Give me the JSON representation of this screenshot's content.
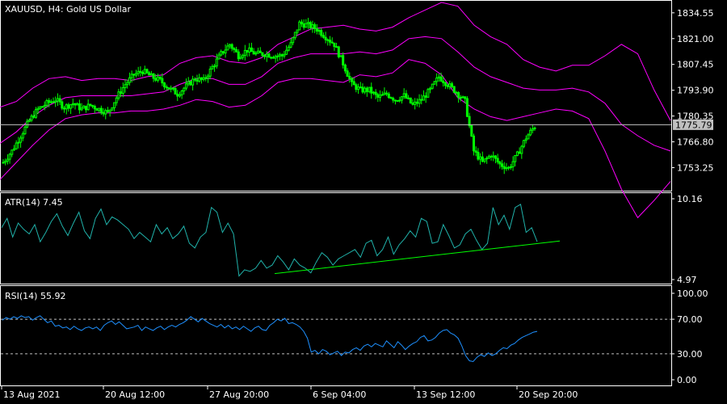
{
  "panes": {
    "main": {
      "symbol": "XAUUSD",
      "timeframe": "H4",
      "title": "XAUUSD, H4:  Gold US Dollar",
      "current_price": "1775.79"
    },
    "atr": {
      "title": "ATR(14) 7.45"
    },
    "rsi": {
      "title": "RSI(14) 55.92"
    }
  },
  "colors": {
    "background": "#000000",
    "candle": "#00ff00",
    "bollinger": "#ff00ff",
    "atr_line": "#20b2aa",
    "atr_trendline": "#00ff00",
    "rsi_line": "#1e90ff",
    "grid_level": "#c0c0c0",
    "axis_text": "#ffffff",
    "price_box": "#c0c0c0"
  },
  "chart_data": [
    {
      "type": "candlestick",
      "name": "main",
      "y_axis_ticks": [
        "1834.55",
        "1821.00",
        "1807.45",
        "1793.90",
        "1780.35",
        "1766.80",
        "1753.25"
      ],
      "ylim": [
        1742,
        1840
      ],
      "current_price": 1775.79,
      "close_path_points": [
        [
          0,
          1756
        ],
        [
          4,
          1762
        ],
        [
          8,
          1770
        ],
        [
          12,
          1778
        ],
        [
          16,
          1784
        ],
        [
          20,
          1787
        ],
        [
          24,
          1789
        ],
        [
          28,
          1785
        ],
        [
          32,
          1787
        ],
        [
          36,
          1784
        ],
        [
          40,
          1786
        ],
        [
          44,
          1784
        ],
        [
          48,
          1782
        ],
        [
          52,
          1790
        ],
        [
          56,
          1797
        ],
        [
          60,
          1802
        ],
        [
          64,
          1804
        ],
        [
          68,
          1801
        ],
        [
          72,
          1799
        ],
        [
          76,
          1795
        ],
        [
          80,
          1792
        ],
        [
          84,
          1796
        ],
        [
          88,
          1800
        ],
        [
          92,
          1799
        ],
        [
          96,
          1806
        ],
        [
          100,
          1813
        ],
        [
          104,
          1818
        ],
        [
          108,
          1812
        ],
        [
          112,
          1815
        ],
        [
          116,
          1813
        ],
        [
          120,
          1813
        ],
        [
          124,
          1812
        ],
        [
          128,
          1812
        ],
        [
          132,
          1818
        ],
        [
          136,
          1829
        ],
        [
          140,
          1828
        ],
        [
          144,
          1826
        ],
        [
          148,
          1822
        ],
        [
          152,
          1818
        ],
        [
          156,
          1808
        ],
        [
          160,
          1797
        ],
        [
          164,
          1794
        ],
        [
          168,
          1794
        ],
        [
          172,
          1790
        ],
        [
          176,
          1792
        ],
        [
          180,
          1789
        ],
        [
          184,
          1791
        ],
        [
          188,
          1786
        ],
        [
          192,
          1789
        ],
        [
          196,
          1794
        ],
        [
          200,
          1801
        ],
        [
          204,
          1797
        ],
        [
          208,
          1793
        ],
        [
          212,
          1788
        ],
        [
          216,
          1762
        ],
        [
          220,
          1756
        ],
        [
          224,
          1760
        ],
        [
          228,
          1755
        ],
        [
          232,
          1753
        ],
        [
          236,
          1760
        ],
        [
          240,
          1769
        ],
        [
          244,
          1775
        ]
      ],
      "close_x_range": [
        0,
        244
      ],
      "bb_upper": [
        1785,
        1788,
        1795,
        1800,
        1801,
        1799,
        1800,
        1800,
        1799,
        1801,
        1802,
        1808,
        1811,
        1812,
        1809,
        1808,
        1811,
        1818,
        1822,
        1826,
        1827,
        1828,
        1826,
        1825,
        1827,
        1832,
        1836,
        1840,
        1838,
        1828,
        1822,
        1818,
        1810,
        1806,
        1804,
        1807,
        1807,
        1812,
        1818,
        1813,
        1794,
        1778
      ],
      "bb_middle": [
        1766,
        1772,
        1780,
        1786,
        1790,
        1791,
        1791,
        1791,
        1791,
        1792,
        1793,
        1797,
        1800,
        1800,
        1797,
        1797,
        1801,
        1808,
        1811,
        1813,
        1813,
        1813,
        1814,
        1813,
        1815,
        1821,
        1822,
        1821,
        1814,
        1806,
        1801,
        1798,
        1795,
        1794,
        1794,
        1795,
        1793,
        1787,
        1776,
        1770,
        1765,
        1762
      ],
      "bb_lower": [
        1747,
        1756,
        1765,
        1773,
        1779,
        1781,
        1782,
        1782,
        1783,
        1783,
        1784,
        1786,
        1789,
        1788,
        1785,
        1786,
        1791,
        1798,
        1800,
        1800,
        1799,
        1798,
        1802,
        1801,
        1803,
        1810,
        1808,
        1802,
        1790,
        1784,
        1780,
        1778,
        1780,
        1782,
        1784,
        1783,
        1779,
        1762,
        1742,
        1727,
        1736,
        1746
      ]
    },
    {
      "type": "line",
      "name": "atr",
      "title": "ATR(14) 7.45",
      "y_axis_ticks": [
        "10.16",
        "4.97"
      ],
      "ylim": [
        4.97,
        10.16
      ],
      "values": [
        8.3,
        8.9,
        7.7,
        8.6,
        8.2,
        7.9,
        8.5,
        7.4,
        8.0,
        8.7,
        9.2,
        8.4,
        7.8,
        8.6,
        9.3,
        8.1,
        7.6,
        8.9,
        9.5,
        8.5,
        9.0,
        8.8,
        8.5,
        8.2,
        7.6,
        8.0,
        7.7,
        7.4,
        8.5,
        7.9,
        8.3,
        7.6,
        7.9,
        8.4,
        7.3,
        7.0,
        7.7,
        8.0,
        9.6,
        9.3,
        8.0,
        8.6,
        7.9,
        5.2,
        5.6,
        5.5,
        5.7,
        6.2,
        5.7,
        5.9,
        6.5,
        6.1,
        5.6,
        6.3,
        5.9,
        5.7,
        5.4,
        6.1,
        6.7,
        6.4,
        5.9,
        6.3,
        6.5,
        6.7,
        6.9,
        6.4,
        7.3,
        7.5,
        6.5,
        6.9,
        7.7,
        6.6,
        7.2,
        7.6,
        8.1,
        7.7,
        8.9,
        8.7,
        7.3,
        7.4,
        8.5,
        7.8,
        7.0,
        7.2,
        7.9,
        8.2,
        7.5,
        6.9,
        7.3,
        9.6,
        8.5,
        9.1,
        8.2,
        9.6,
        9.8,
        8.0,
        8.3,
        7.4
      ],
      "trendline": {
        "from_index": 45,
        "from_value": 5.35,
        "to_index": 97,
        "to_value": 7.45
      }
    },
    {
      "type": "line",
      "name": "rsi",
      "title": "RSI(14) 55.92",
      "y_axis_ticks": [
        "100.00",
        "70.00",
        "30.00",
        "0.00"
      ],
      "ylim": [
        0,
        100
      ],
      "levels": [
        70,
        30
      ],
      "values": [
        69,
        72,
        70,
        73,
        71,
        74,
        72,
        73,
        69,
        72,
        74,
        70,
        66,
        68,
        62,
        63,
        60,
        61,
        58,
        62,
        59,
        57,
        60,
        61,
        59,
        61,
        57,
        63,
        66,
        68,
        64,
        67,
        63,
        59,
        60,
        61,
        63,
        57,
        61,
        59,
        57,
        60,
        62,
        58,
        61,
        63,
        61,
        64,
        66,
        69,
        73,
        70,
        67,
        71,
        68,
        65,
        63,
        61,
        64,
        60,
        63,
        59,
        61,
        58,
        62,
        59,
        56,
        60,
        62,
        58,
        57,
        63,
        66,
        70,
        68,
        71,
        65,
        66,
        64,
        61,
        56,
        48,
        32,
        34,
        30,
        35,
        33,
        29,
        31,
        33,
        28,
        32,
        31,
        35,
        37,
        34,
        39,
        41,
        38,
        42,
        40,
        38,
        45,
        41,
        37,
        44,
        40,
        35,
        39,
        42,
        44,
        49,
        51,
        45,
        46,
        49,
        54,
        57,
        58,
        54,
        52,
        48,
        39,
        28,
        22,
        21,
        26,
        29,
        27,
        31,
        28,
        30,
        34,
        37,
        36,
        40,
        42,
        46,
        49,
        51,
        53,
        55,
        56
      ]
    }
  ],
  "x_axis": {
    "labels": [
      {
        "text": "13 Aug 2021",
        "position": 0.0
      },
      {
        "text": "20 Aug 12:00",
        "position": 0.2
      },
      {
        "text": "27 Aug 20:00",
        "position": 0.4
      },
      {
        "text": "6 Sep 04:00",
        "position": 0.6
      },
      {
        "text": "13 Sep 12:00",
        "position": 0.76
      },
      {
        "text": "20 Sep 20:00",
        "position": 0.92
      }
    ]
  }
}
